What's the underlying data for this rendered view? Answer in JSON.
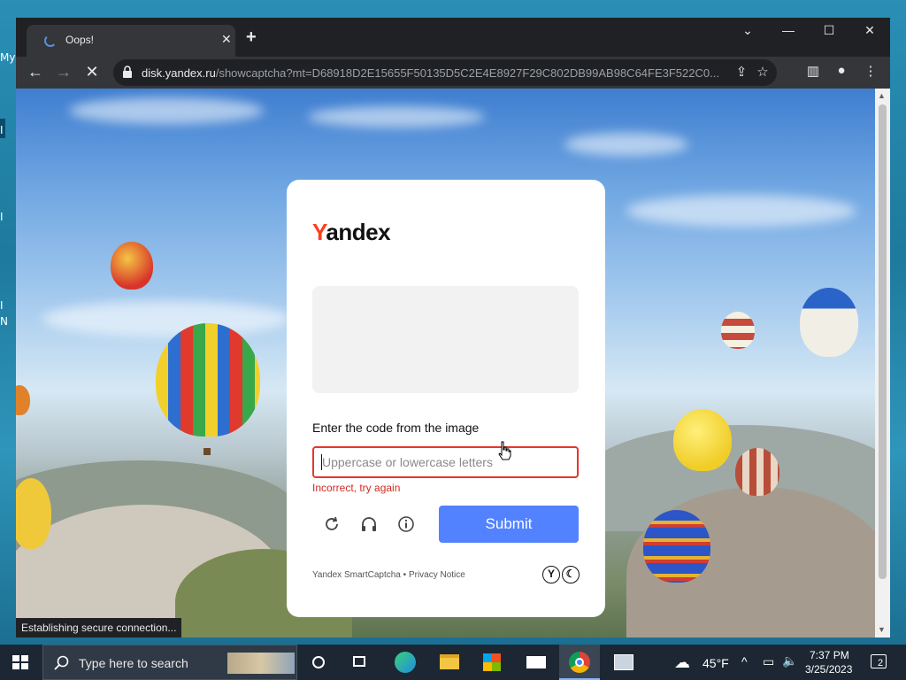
{
  "desktop": {
    "fragments": [
      "My",
      "I",
      "I",
      "I",
      "N"
    ]
  },
  "browser": {
    "tab_title": "Oops!",
    "url_host": "disk.yandex.ru",
    "url_path": "/showcaptcha?mt=D68918D2E15655F50135D5C2E4E8927F29C802DB99AB98C64FE3F522C0...",
    "status_text": "Establishing secure connection..."
  },
  "captcha": {
    "logo_initial": "Y",
    "logo_rest": "andex",
    "prompt": "Enter the code from the image",
    "input_placeholder": "Uppercase or lowercase letters",
    "error_text": "Incorrect, try again",
    "submit_label": "Submit",
    "footer_service": "Yandex SmartCaptcha",
    "footer_separator": " • ",
    "footer_privacy": "Privacy Notice",
    "badge_left": "Y",
    "badge_right": "☾"
  },
  "taskbar": {
    "search_placeholder": "Type here to search",
    "weather_temp": "45°F",
    "time": "7:37 PM",
    "date": "3/25/2023",
    "notification_count": "2"
  },
  "colors": {
    "yandex_red": "#fc3f1d",
    "submit_blue": "#5282ff",
    "error_red": "#d22b22"
  }
}
